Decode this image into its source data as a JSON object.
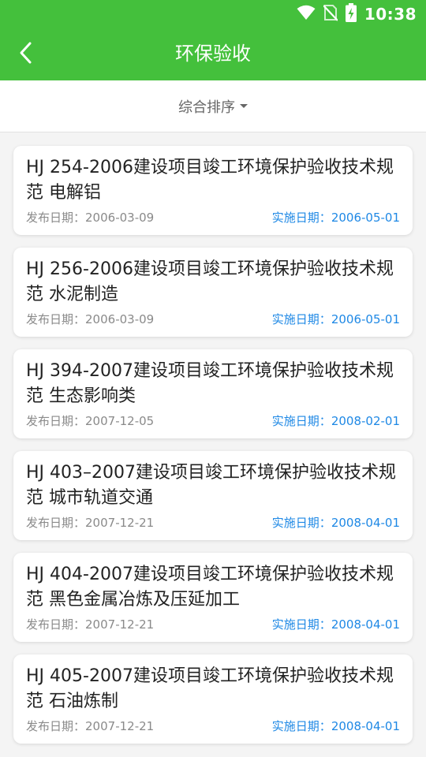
{
  "status_bar": {
    "time": "10:38",
    "icons": [
      "wifi-icon",
      "no-sim-icon",
      "battery-charging-icon"
    ]
  },
  "header": {
    "title": "环保验收",
    "back_icon": "chevron-left-icon",
    "background_color": "#44c03c"
  },
  "sort": {
    "label": "综合排序",
    "icon": "caret-down-icon"
  },
  "list": {
    "items": [
      {
        "title": "HJ 254-2006建设项目竣工环境保护验收技术规范 电解铝",
        "published_label": "发布日期：",
        "published": "2006-03-09",
        "implemented_label": "实施日期：",
        "implemented": "2006-05-01"
      },
      {
        "title": "HJ 256-2006建设项目竣工环境保护验收技术规范 水泥制造",
        "published_label": "发布日期：",
        "published": "2006-03-09",
        "implemented_label": "实施日期：",
        "implemented": "2006-05-01"
      },
      {
        "title": "HJ 394-2007建设项目竣工环境保护验收技术规范 生态影响类",
        "published_label": "发布日期：",
        "published": "2007-12-05",
        "implemented_label": "实施日期：",
        "implemented": "2008-02-01"
      },
      {
        "title": "HJ 403–2007建设项目竣工环境保护验收技术规范 城市轨道交通",
        "published_label": "发布日期：",
        "published": "2007-12-21",
        "implemented_label": "实施日期：",
        "implemented": "2008-04-01"
      },
      {
        "title": "HJ 404-2007建设项目竣工环境保护验收技术规范 黑色金属冶炼及压延加工",
        "published_label": "发布日期：",
        "published": "2007-12-21",
        "implemented_label": "实施日期：",
        "implemented": "2008-04-01"
      },
      {
        "title": "HJ 405-2007建设项目竣工环境保护验收技术规范 石油炼制",
        "published_label": "发布日期：",
        "published": "2007-12-21",
        "implemented_label": "实施日期：",
        "implemented": "2008-04-01"
      }
    ]
  },
  "colors": {
    "accent": "#44c03c",
    "implemented_text": "#1e88e5",
    "published_text": "#8a8a8a"
  }
}
